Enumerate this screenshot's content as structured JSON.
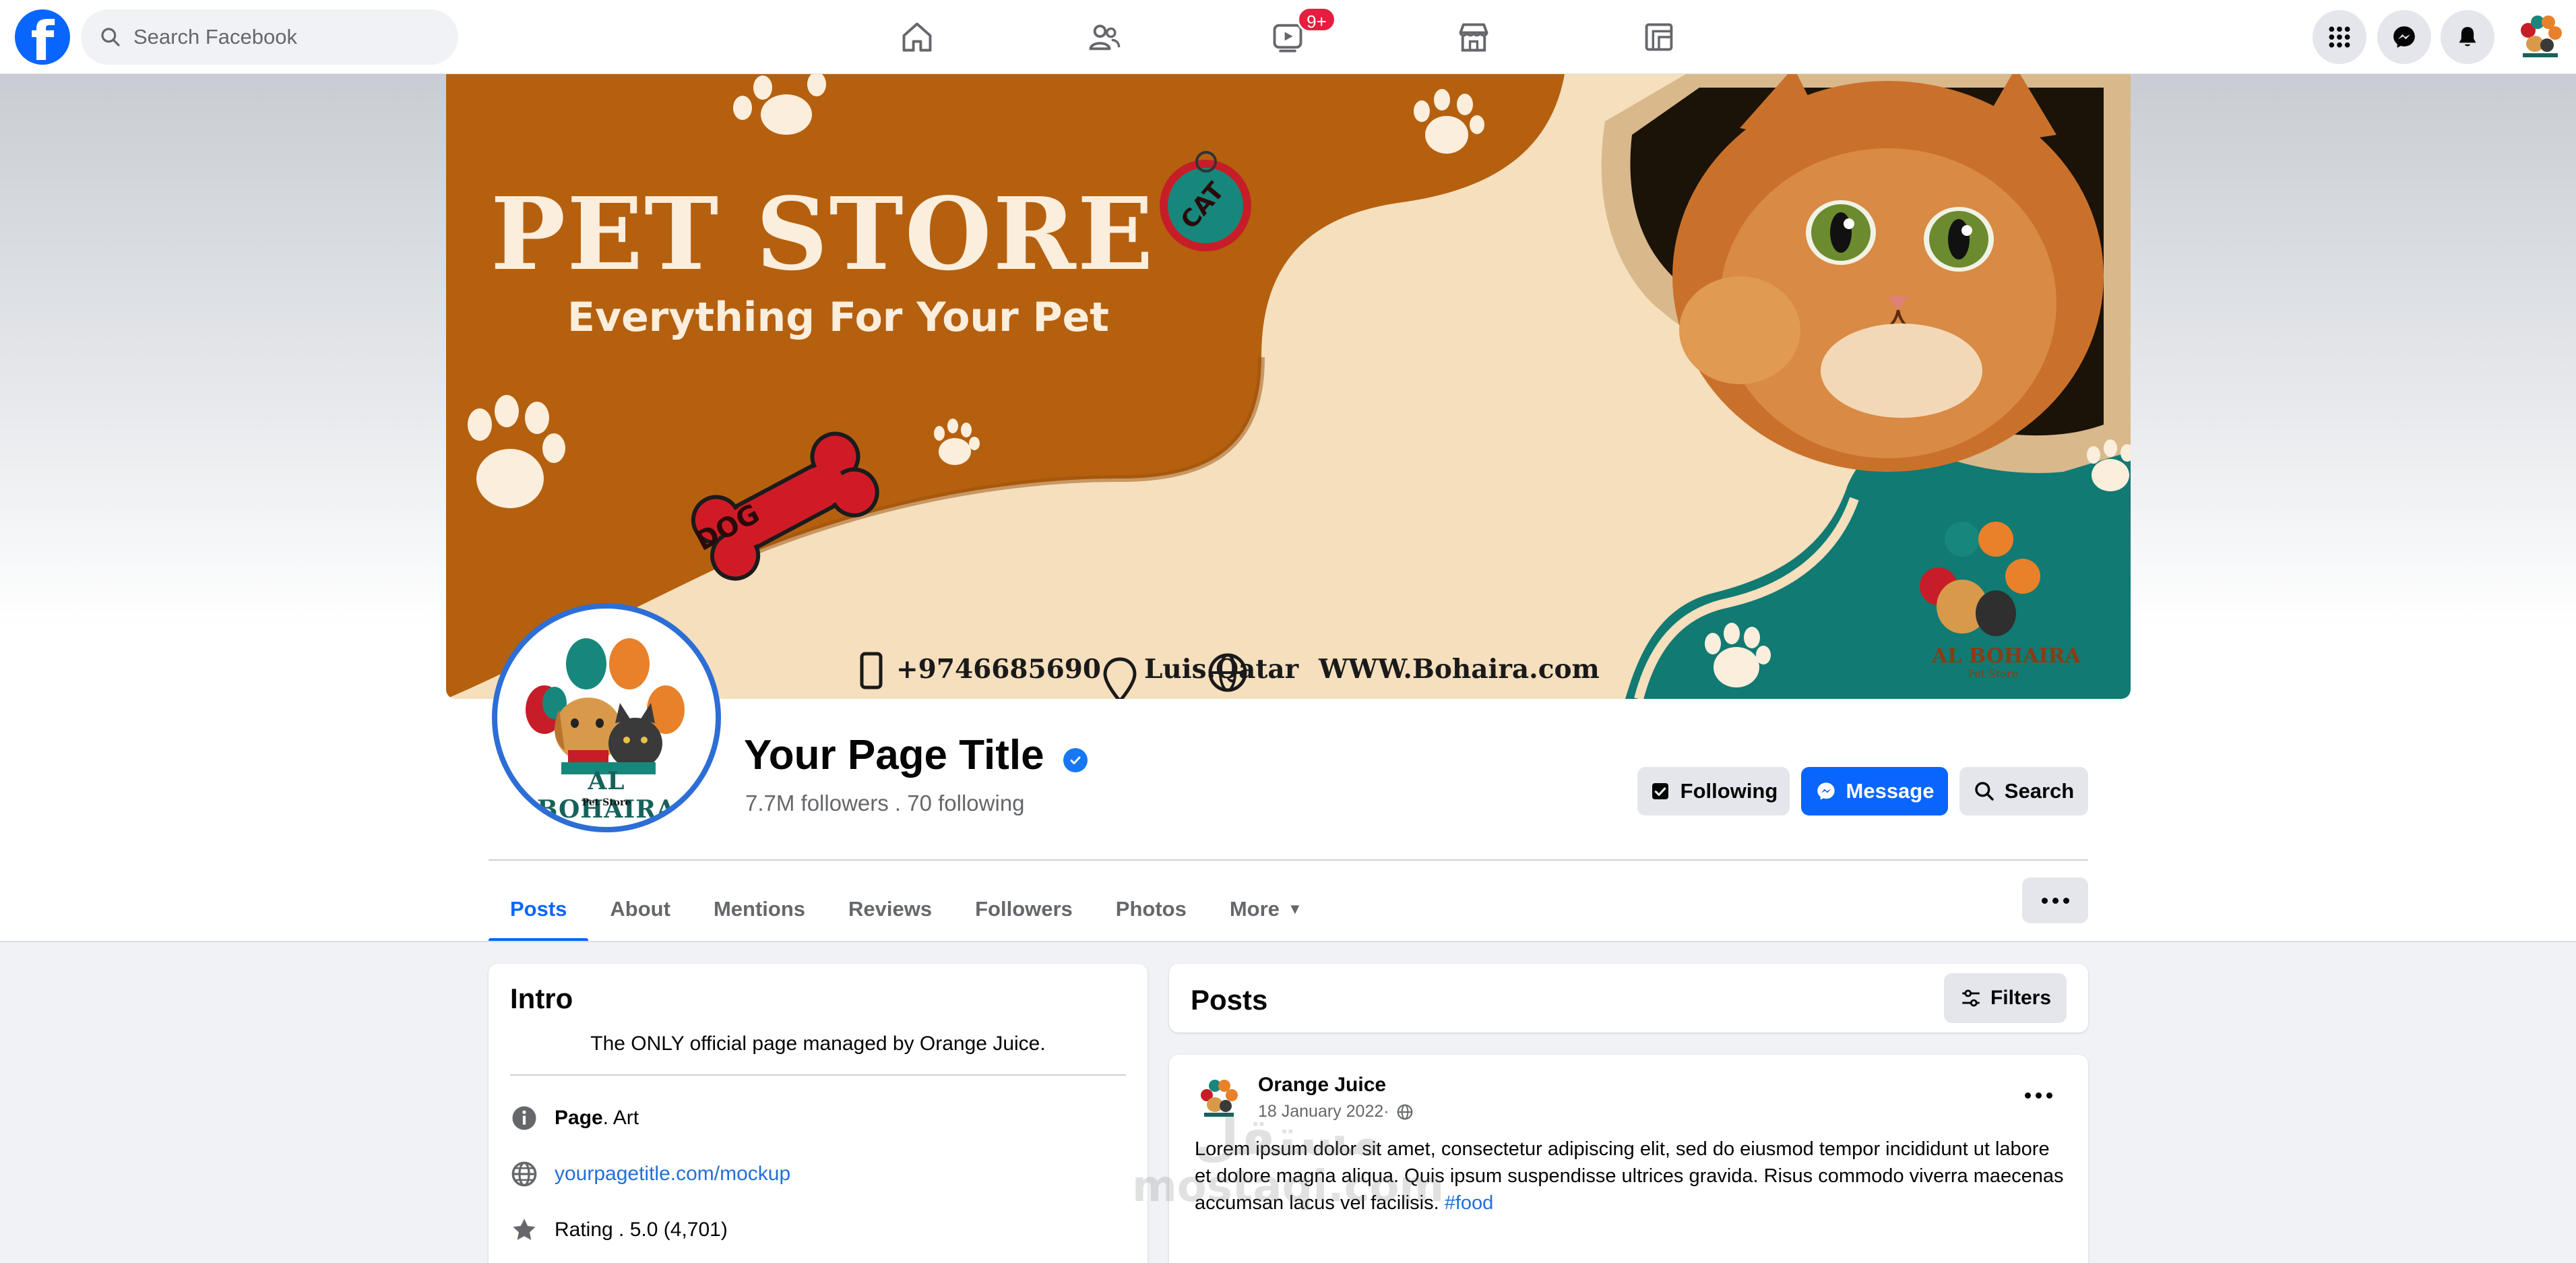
{
  "topnav": {
    "logo": "f",
    "search_placeholder": "Search Facebook",
    "video_badge": "9+",
    "icons": [
      "home-icon",
      "friends-icon",
      "video-icon",
      "marketplace-icon",
      "gaming-icon",
      "menu-grid-icon",
      "messenger-icon",
      "notifications-icon"
    ]
  },
  "cover": {
    "title": "PET STORE",
    "subtitle": "Everything For Your Pet",
    "phone": "+9746685690",
    "location": "Luis.Qatar",
    "website": "WWW.Bohaira.com",
    "tag_cat": "CAT",
    "tag_dog": "DOG",
    "logo_name": "AL BOHAIRA",
    "logo_sub": "Pet Store"
  },
  "profile": {
    "logo_name": "AL BOHAIRA",
    "logo_sub": "Pet Store",
    "page_title": "Your Page Title",
    "followers_text": "7.7M followers . 70 following",
    "buttons": {
      "following": "Following",
      "message": "Message",
      "search": "Search"
    }
  },
  "tabs": {
    "items": [
      {
        "label": "Posts",
        "active": true
      },
      {
        "label": "About"
      },
      {
        "label": "Mentions"
      },
      {
        "label": "Reviews"
      },
      {
        "label": "Followers"
      },
      {
        "label": "Photos"
      },
      {
        "label": "More"
      }
    ]
  },
  "intro": {
    "title": "Intro",
    "bio": "The ONLY official page managed by Orange Juice.",
    "category_label": "Page",
    "category_value": " . Art",
    "website": "yourpagetitle.com/mockup",
    "rating": "Rating . 5.0 (4,701)"
  },
  "posts": {
    "title": "Posts",
    "filters_label": "Filters",
    "post": {
      "author": "Orange Juice",
      "date": "18 January 2022",
      "date_sep": " · ",
      "text": "Lorem ipsum dolor sit amet, consectetur adipiscing elit, sed do eiusmod tempor incididunt ut labore et dolore magna aliqua. Quis ipsum suspendisse ultrices gravida. Risus commodo viverra maecenas accumsan lacus vel facilisis. ",
      "hashtag": "#food"
    }
  },
  "watermark": {
    "arabic": "مستقل",
    "latin": "mostaqi.com"
  },
  "colors": {
    "brand_blue": "#0866ff",
    "cover_orange": "#b5600f",
    "cover_teal": "#117a72",
    "cover_cream": "#f5dfbd"
  }
}
